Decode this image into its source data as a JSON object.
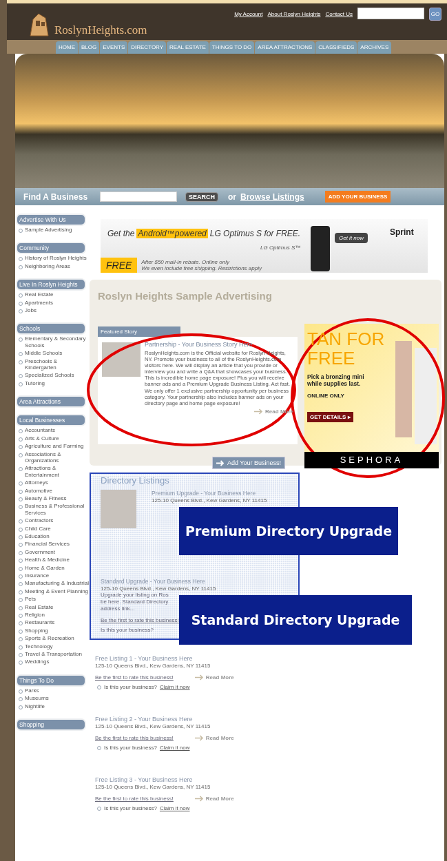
{
  "header": {
    "logo": "RoslynHeights.com",
    "links": [
      "My Account",
      "About Roslyn Heights",
      "Contact Us"
    ],
    "search_button": "GO"
  },
  "nav": [
    "HOME",
    "BLOG",
    "EVENTS",
    "DIRECTORY",
    "REAL ESTATE",
    "THINGS TO DO",
    "AREA ATTRACTIONS",
    "CLASSIFIEDS",
    "ARCHIVES"
  ],
  "find_bar": {
    "label": "Find A Business",
    "search_button": "SEARCH",
    "or": "or",
    "browse_link": "Browse Listings",
    "add_button": "ADD YOUR BUSINESS"
  },
  "sidebar": [
    {
      "title": "Advertise With Us",
      "items": [
        "Sample Advertising"
      ]
    },
    {
      "title": "Community",
      "items": [
        "History of Roslyn Heights",
        "Neighboring Areas"
      ]
    },
    {
      "title": "Live In Roslyn Heights",
      "items": [
        "Real Estate",
        "Apartments",
        "Jobs"
      ]
    },
    {
      "title": "Schools",
      "items": [
        "Elementary & Secondary Schools",
        "Middle Schools",
        "Preschools & Kindergarten",
        "Specialized Schools",
        "Tutoring"
      ]
    },
    {
      "title": "Area Attractions"
    },
    {
      "title": "Local Businesses",
      "items": [
        "Accountants",
        "Arts & Culture",
        "Agriculture and Farming",
        "Associations & Organizations",
        "Attractions & Entertainment",
        "Attorneys",
        "Automotive",
        "Beauty & Fitness",
        "Business & Professional Services",
        "Contractors",
        "Child Care",
        "Education",
        "Financial Services",
        "Government",
        "Health & Medicine",
        "Home & Garden",
        "Insurance",
        "Manufacturing & Industrial",
        "Meeting & Event Planning",
        "Pets",
        "Real Estate",
        "Religion",
        "Restaurants",
        "Shopping",
        "Sports & Recreation",
        "Technology",
        "Travel & Transportation",
        "Weddings"
      ]
    },
    {
      "title": "Things To Do",
      "items": [
        "Parks",
        "Museums",
        "Nightlife"
      ]
    },
    {
      "title": "Shopping"
    }
  ],
  "banner_ad": {
    "lead": "Get the",
    "highlight": "Android™powered",
    "product": "LG Optimus S for FREE.",
    "phone_label": "LG Optimus S™",
    "button": "Get it now",
    "brand": "Sprint",
    "free": "FREE",
    "fine_print": [
      "After $50 mail-in rebate. Online only",
      "We even include free shipping. Restrictions apply"
    ]
  },
  "sample_panel": {
    "title": "Roslyn Heights Sample Advertising",
    "featured_tab": "Featured Story",
    "story_title": "Partnership - Your Business Story Here",
    "story_body": "RoslynHeights.com is the Official website for Roslyn Heights, NY. Promote your business to all of the RoslynHeights.com visitors here. We will display an article that you provide or interview you and write a Q&A that showcases your business. This is incredible home page exposure! Plus you will receive banner ads and a Premium Upgrade Business Listing. Act fast. We only offer 1 exclusive partnership opportunity per business category. Your partnership also includes banner ads on your directory page and home page exposure!",
    "read_more": "Read More"
  },
  "side_ad": {
    "headline": "TAN FOR FREE",
    "text": "Pick a bronzing mini while supplies last.",
    "note": "ONLINE ONLY",
    "button": "GET DETAILS ▸",
    "brand": "SEPHORA"
  },
  "add_business_button": "Add Your Business!",
  "directory": {
    "title": "Directory Listings",
    "premium_title": "Premium Upgrade - Your Business Here",
    "premium_address": "125-10 Queens Blvd., Kew Gardens, NY 11415",
    "standard_title": "Standard Upgrade - Your Business Here",
    "standard_address": "125-10 Queens Blvd., Kew Gardens, NY 11415",
    "standard_lines": [
      "Upgrade your listing on Ros",
      "be here. Standard Directory",
      "address link..."
    ],
    "rate_link": "Be the first to rate this business!",
    "claim_prompt": "Is this your business?"
  },
  "annotations": [
    "Premium Directory Upgrade",
    "Standard Directory Upgrade"
  ],
  "free_listings": [
    {
      "title": "Free Listing 1 - Your Business Here",
      "address": "125-10 Queens Blvd., Kew Gardens, NY 11415",
      "rate_link": "Be the first to rate this business!",
      "claim_prompt": "Is this your business?",
      "claim_link": "Claim it now",
      "read_more": "Read More"
    },
    {
      "title": "Free Listing 2 - Your Business Here",
      "address": "125-10 Queens Blvd., Kew Gardens, NY 11415",
      "rate_link": "Be the first to rate this business!",
      "claim_prompt": "Is this your business?",
      "claim_link": "Claim it now",
      "read_more": "Read More"
    },
    {
      "title": "Free Listing 3 - Your Business Here",
      "address": "125-10 Queens Blvd., Kew Gardens, NY 11415",
      "rate_link": "Be the first to rate this business!",
      "claim_prompt": "Is this your business?",
      "claim_link": "Claim it now",
      "read_more": "Read More"
    }
  ]
}
